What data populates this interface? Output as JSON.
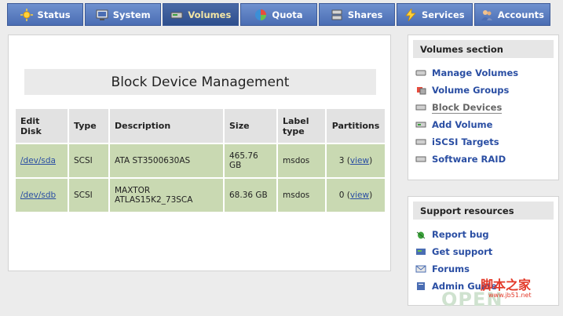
{
  "nav": {
    "tabs": [
      {
        "label": "Status",
        "icon": "sun-icon",
        "active": false
      },
      {
        "label": "System",
        "icon": "monitor-icon",
        "active": false
      },
      {
        "label": "Volumes",
        "icon": "disk-icon",
        "active": true
      },
      {
        "label": "Quota",
        "icon": "pie-icon",
        "active": false
      },
      {
        "label": "Shares",
        "icon": "server-icon",
        "active": false
      },
      {
        "label": "Services",
        "icon": "lightning-icon",
        "active": false
      },
      {
        "label": "Accounts",
        "icon": "users-icon",
        "active": false
      }
    ]
  },
  "main": {
    "title": "Block Device Management",
    "table": {
      "headers": {
        "edit_disk": "Edit Disk",
        "type": "Type",
        "description": "Description",
        "size": "Size",
        "label_type": "Label type",
        "partitions": "Partitions"
      },
      "rows": [
        {
          "disk": "/dev/sda",
          "type": "SCSI",
          "description": "ATA ST3500630AS",
          "size": "465.76 GB",
          "label_type": "msdos",
          "partitions_count": "3 (",
          "view": "view",
          "close": ")"
        },
        {
          "disk": "/dev/sdb",
          "type": "SCSI",
          "description": "MAXTOR ATLAS15K2_73SCA",
          "size": "68.36 GB",
          "label_type": "msdos",
          "partitions_count": "0 (",
          "view": "view",
          "close": ")"
        }
      ]
    }
  },
  "volumes_section": {
    "title": "Volumes section",
    "items": [
      {
        "label": "Manage Volumes",
        "icon": "disk-icon"
      },
      {
        "label": "Volume Groups",
        "icon": "cube-icon"
      },
      {
        "label": "Block Devices",
        "icon": "drive-icon",
        "current": true
      },
      {
        "label": "Add Volume",
        "icon": "drive-add-icon"
      },
      {
        "label": "iSCSI Targets",
        "icon": "drive-icon"
      },
      {
        "label": "Software RAID",
        "icon": "drive-icon"
      }
    ]
  },
  "support": {
    "title": "Support resources",
    "items": [
      {
        "label": "Report bug",
        "icon": "bug-icon"
      },
      {
        "label": "Get support",
        "icon": "support-icon"
      },
      {
        "label": "Forums",
        "icon": "mail-icon"
      },
      {
        "label": "Admin Guide",
        "icon": "book-icon"
      }
    ]
  },
  "watermark": {
    "line1": "脚本之家",
    "line2": "OPEN",
    "line3": "www.jb51.net"
  },
  "colors": {
    "nav": "#4a6db3",
    "row": "#c9d9b2",
    "link": "#2a4ea3"
  }
}
